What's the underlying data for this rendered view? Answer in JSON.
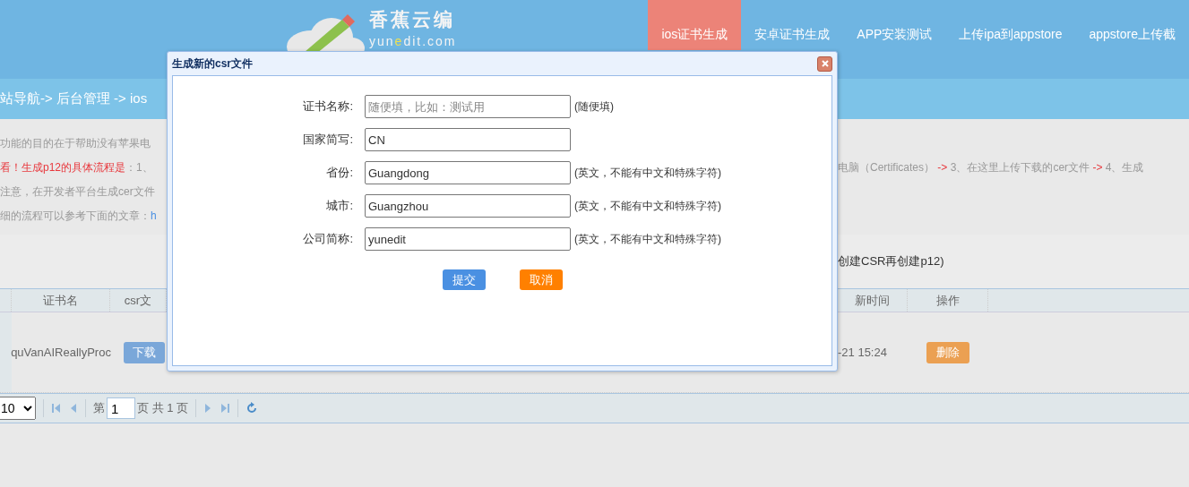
{
  "logo": {
    "title": "香蕉云编",
    "domain_parts": [
      {
        "text": "yun",
        "highlight": false
      },
      {
        "text": "e",
        "highlight": true
      },
      {
        "text": "dit.com",
        "highlight": false
      }
    ]
  },
  "nav": [
    {
      "label": "ios证书生成",
      "selected": true
    },
    {
      "label": "安卓证书生成",
      "selected": false
    },
    {
      "label": "APP安装测试",
      "selected": false
    },
    {
      "label": "上传ipa到appstore",
      "selected": false
    },
    {
      "label": "appstore上传截",
      "selected": false
    }
  ],
  "breadcrumb": "站导航-> 后台管理 -> ios",
  "info_lines": [
    {
      "left": "功能的目的在于帮助没有苹果电"
    },
    {
      "left": "**看！生成p12的具体流程是**：1、",
      "right": "电脑（Certificates） **->** 3、在这里上传下载的cer文件 **->** 4、生成"
    },
    {
      "left": "注意，在开发者平台生成cer文件"
    },
    {
      "left": "细的流程可以参考下面的文章：",
      "link": "h"
    }
  ],
  "note_right": "创建CSR再创建p12)",
  "table": {
    "columns_left": [
      "证书名",
      "csr文"
    ],
    "columns_right": [
      "新时间",
      "操作"
    ],
    "rows": [
      {
        "name": "quVanAIReallyProc",
        "download": "下载",
        "time": "-21 15:24",
        "delete": "删除"
      }
    ]
  },
  "pager": {
    "page_size": "10",
    "page_prefix": "第",
    "page": "1",
    "page_suffix": "页 共 1 页"
  },
  "dialog": {
    "title": "生成新的csr文件",
    "fields": [
      {
        "label": "证书名称:",
        "placeholder": "随便填，比如：测试用",
        "hint": "(随便填)"
      },
      {
        "label": "国家简写:",
        "value": "CN"
      },
      {
        "label": "省份:",
        "value": "Guangdong",
        "hint": "(英文，不能有中文和特殊字符)"
      },
      {
        "label": "城市:",
        "value": "Guangzhou",
        "hint": "(英文，不能有中文和特殊字符)"
      },
      {
        "label": "公司简称:",
        "value": "yunedit",
        "hint": "(英文，不能有中文和特殊字符)"
      }
    ],
    "buttons": [
      {
        "label": "提交",
        "kind": "primary"
      },
      {
        "label": "取消",
        "kind": "cancel"
      }
    ]
  }
}
